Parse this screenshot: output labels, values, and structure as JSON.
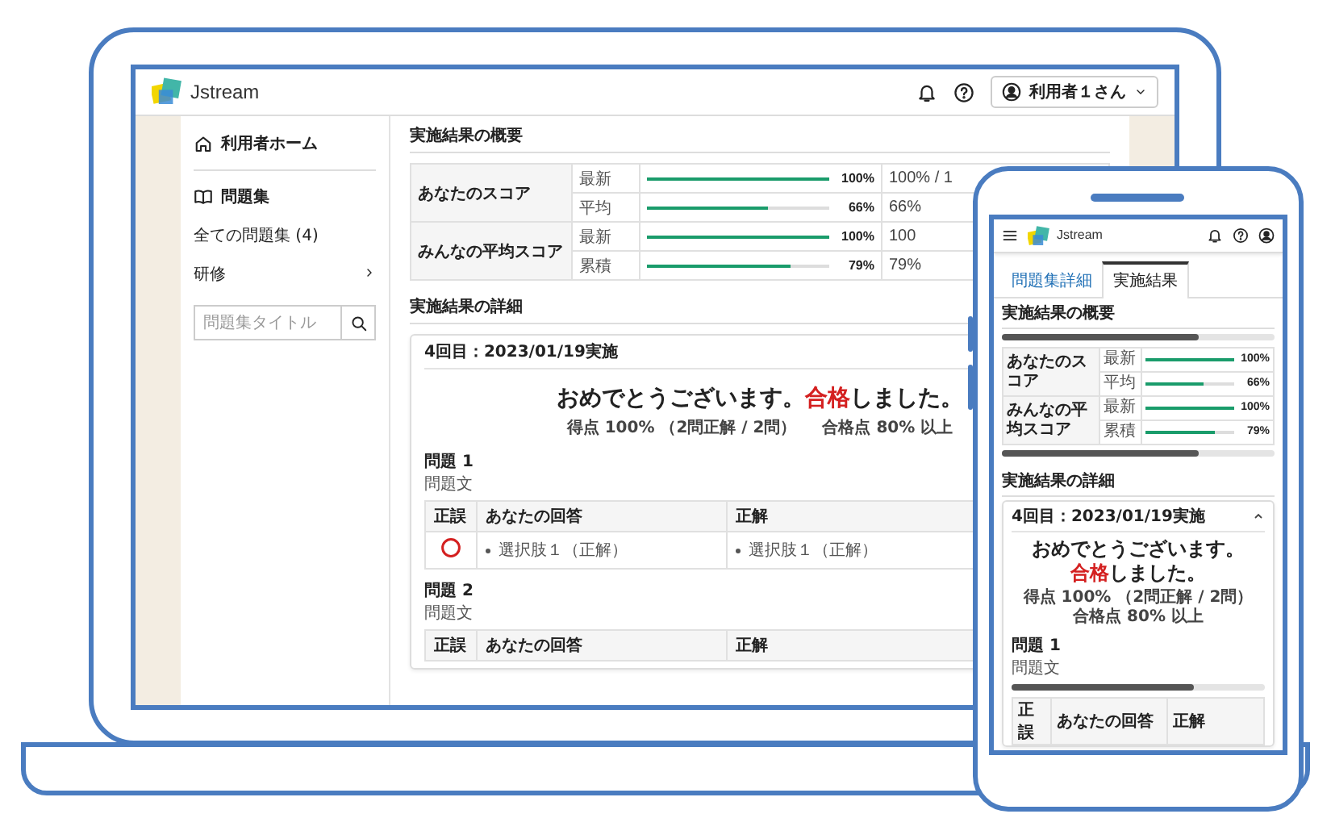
{
  "laptop": {
    "header": {
      "logo": "Jstream",
      "user_button": "利用者１さん"
    },
    "sidebar": {
      "home": "利用者ホーム",
      "section": "問題集",
      "items": [
        {
          "label": "全ての問題集 (4)",
          "has_submenu": false
        },
        {
          "label": "研修",
          "has_submenu": true
        }
      ],
      "search": {
        "placeholder": "問題集タイトル"
      }
    },
    "summary": {
      "title": "実施結果の概要",
      "groups": [
        {
          "label": "あなたのスコア",
          "rows": [
            {
              "name": "最新",
              "level": 1,
              "reading": "100%",
              "column_4": "100% / 1"
            },
            {
              "name": "平均",
              "level": 0.66,
              "reading": "66%",
              "column_4": "66%"
            }
          ]
        },
        {
          "label": "みんなの平均スコア",
          "rows": [
            {
              "name": "最新",
              "level": 1,
              "reading": "100%",
              "column_4": "100"
            },
            {
              "name": "累積",
              "level": 0.79,
              "reading": "79%",
              "column_4": "79%"
            }
          ]
        }
      ]
    },
    "details": {
      "title": "実施結果の詳細",
      "attempt": "4回目：2023/01/19実施",
      "message": {
        "before": "おめでとうございます。",
        "result": "合格",
        "after": "しました。"
      },
      "score": "得点 100% （2問正解 / 2問）",
      "pass_mark": "合格点 80% 以上",
      "questions": [
        {
          "title": "問題 1",
          "text": "問題文",
          "columns": [
            "正誤",
            "あなたの回答",
            "正解"
          ],
          "answers": [
            {
              "correct": true,
              "yours": "選択肢１（正解）",
              "answer": "選択肢１（正解）"
            }
          ]
        },
        {
          "title": "問題 2",
          "text": "問題文",
          "columns": [
            "正誤",
            "あなたの回答",
            "正解"
          ]
        }
      ]
    }
  },
  "phone": {
    "header": {
      "logo": "Jstream"
    },
    "tabs": [
      {
        "label": "問題集詳細",
        "selected": false
      },
      {
        "label": "実施結果",
        "selected": true
      }
    ],
    "summary": {
      "title": "実施結果の概要",
      "groups": [
        {
          "label": "あなたのスコア",
          "rows": [
            {
              "name": "最新",
              "level": 1,
              "reading": "100%"
            },
            {
              "name": "平均",
              "level": 0.66,
              "reading": "66%"
            }
          ]
        },
        {
          "label": "みんなの平均スコア",
          "rows": [
            {
              "name": "最新",
              "level": 1,
              "reading": "100%"
            },
            {
              "name": "累積",
              "level": 0.79,
              "reading": "79%"
            }
          ]
        }
      ]
    },
    "details": {
      "title": "実施結果の詳細",
      "attempt": "4回目：2023/01/19実施",
      "expanded": true,
      "message": {
        "before": "おめでとうございます。",
        "result": "合格",
        "after": "しました。"
      },
      "score": "得点 100% （2問正解 / 2問）",
      "pass_mark": "合格点 80% 以上",
      "questions": [
        {
          "title": "問題 1",
          "text": "問題文",
          "columns": [
            "正誤",
            "あなたの回答",
            "正解"
          ]
        }
      ]
    }
  }
}
